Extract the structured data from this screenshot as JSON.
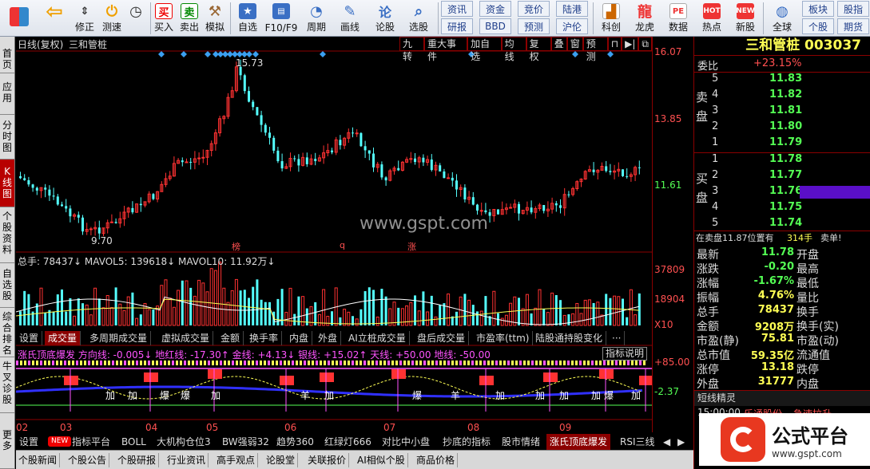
{
  "toolbar": {
    "items": [
      {
        "label": "",
        "icon": "grid-icon"
      },
      {
        "label": "",
        "icon": "back-arrow-icon"
      },
      {
        "label": "修正",
        "icon": "up-down-icon"
      },
      {
        "label": "测速",
        "icon": "power-icon"
      },
      {
        "label": "",
        "icon": "clock-icon"
      },
      {
        "label": "买入",
        "icon": "buy-icon"
      },
      {
        "label": "卖出",
        "icon": "sell-icon"
      },
      {
        "label": "模拟",
        "icon": "hammer-icon"
      },
      {
        "label": "自选",
        "icon": "star-icon"
      },
      {
        "label": "F10/F9",
        "icon": "f10-icon"
      },
      {
        "label": "周期",
        "icon": "period-icon"
      },
      {
        "label": "画线",
        "icon": "pencil-icon"
      },
      {
        "label": "论股",
        "icon": "chat-icon"
      },
      {
        "label": "选股",
        "icon": "magnifier-icon"
      },
      {
        "label": "资讯",
        "icon": ""
      },
      {
        "label": "研报",
        "icon": ""
      },
      {
        "label": "资金",
        "icon": ""
      },
      {
        "label": "BBD",
        "icon": ""
      },
      {
        "label": "竞价",
        "icon": ""
      },
      {
        "label": "预测",
        "icon": ""
      },
      {
        "label": "陆港",
        "icon": ""
      },
      {
        "label": "沪伦",
        "icon": ""
      },
      {
        "label": "科创",
        "icon": "chart-icon"
      },
      {
        "label": "龙虎",
        "icon": "dragon-icon"
      },
      {
        "label": "数据",
        "icon": "pe-icon"
      },
      {
        "label": "热点",
        "icon": "hot-icon"
      },
      {
        "label": "新股",
        "icon": "new-icon"
      },
      {
        "label": "全球",
        "icon": "globe-icon"
      },
      {
        "label": "板块",
        "icon": ""
      },
      {
        "label": "个股",
        "icon": ""
      },
      {
        "label": "股指",
        "icon": ""
      },
      {
        "label": "期货",
        "icon": ""
      }
    ]
  },
  "leftnav": [
    "首页",
    "应用",
    "分时图",
    "K线图",
    "个股资料",
    "自选股",
    "综合排名",
    "牛叉诊股",
    "更多"
  ],
  "chart_header": {
    "title": "日线(复权)",
    "stock": "三和管桩",
    "buttons": [
      "九转",
      "重大事件",
      "加自选",
      "均线",
      "复权",
      "叠",
      "窗",
      "预测"
    ]
  },
  "price_axis": [
    "16.07",
    "13.85",
    "11.61"
  ],
  "price_annotations": {
    "high": "15.73",
    "low": "9.70",
    "markers": [
      "榜",
      "q",
      "涨"
    ]
  },
  "volume": {
    "legend": "总手: 78437↓ MAVOL5: 139618↓ MAVOL10: 11.92万↓",
    "axis": [
      "37809",
      "18904",
      "X10"
    ]
  },
  "vol_tabs": [
    "设置",
    "成交量",
    "多周期成交量",
    "虚拟成交量",
    "金额",
    "换手率",
    "内盘",
    "外盘",
    "AI立桩成交量",
    "盘后成交量",
    "市盈率(ttm)",
    "陆股通持股变化",
    "···"
  ],
  "indicator": {
    "legend": "涨氏顶底爆发 方向线: -0.005↓ 地红线: -17.30↑ 金线: +4.13↓ 银线: +15.02↑ 天线: +50.00 地线: -50.00",
    "button": "指标说明",
    "axis": [
      "+85.00",
      "-2.37"
    ],
    "labels": [
      "加",
      "加",
      "爆",
      "爆",
      "加",
      "羊",
      "加",
      "爆",
      "羊",
      "加",
      "加",
      "加",
      "加",
      "爆",
      "加"
    ]
  },
  "months": [
    "02",
    "03",
    "04",
    "05",
    "06",
    "07",
    "08",
    "09"
  ],
  "bottom_tabs": [
    "设置",
    "NEW",
    "指标平台",
    "BOLL",
    "大机构仓位3",
    "BW强弱32",
    "趋势360",
    "红绿灯666",
    "对比中小盘",
    "抄底的指标",
    "股市情绪",
    "涨氏顶底爆发",
    "RSI三线"
  ],
  "bottom_tabs2": [
    "个股新闻",
    "个股公告",
    "个股研报",
    "行业资讯",
    "高手观点",
    "论股堂",
    "关联报价",
    "AI相似个股",
    "商品价格"
  ],
  "right": {
    "name": "三和管桩",
    "code": "003037",
    "weibi": {
      "label": "委比",
      "value": "+23.15%"
    },
    "sell_label": "卖盘",
    "buy_label": "买盘",
    "sells": [
      {
        "lv": "5",
        "price": "11.83"
      },
      {
        "lv": "4",
        "price": "11.82"
      },
      {
        "lv": "3",
        "price": "11.81"
      },
      {
        "lv": "2",
        "price": "11.80"
      },
      {
        "lv": "1",
        "price": "11.79"
      }
    ],
    "buys": [
      {
        "lv": "1",
        "price": "11.78"
      },
      {
        "lv": "2",
        "price": "11.77"
      },
      {
        "lv": "3",
        "price": "11.76"
      },
      {
        "lv": "4",
        "price": "11.75"
      },
      {
        "lv": "5",
        "price": "11.74"
      }
    ],
    "notice": "在卖盘11.87位置有",
    "notice_val": "314手",
    "notice_end": "卖单!",
    "stats": [
      [
        "最新",
        "11.78",
        "开盘",
        ""
      ],
      [
        "涨跌",
        "-0.20",
        "最高",
        ""
      ],
      [
        "涨幅",
        "-1.67%",
        "最低",
        ""
      ],
      [
        "振幅",
        "4.76%",
        "量比",
        ""
      ],
      [
        "总手",
        "78437",
        "换手",
        ""
      ],
      [
        "金额",
        "9208万",
        "换手(实)",
        ""
      ],
      [
        "市盈(静)",
        "75.81",
        "市盈(动)",
        ""
      ],
      [
        "总市值",
        "59.35亿",
        "流通值",
        ""
      ],
      [
        "涨停",
        "13.18",
        "跌停",
        ""
      ],
      [
        "外盘",
        "31777",
        "内盘",
        ""
      ]
    ],
    "section": "短线精灵",
    "feed": [
      {
        "time": "15:00:00",
        "name": "乐通股份",
        "event": "急速拉升"
      }
    ]
  },
  "watermark": "www.gspt.com",
  "logo": {
    "text": "公式平台",
    "url": "www.gspt.com"
  },
  "colors": {
    "up": "#ff3232",
    "down": "#54ffff",
    "yellow": "#ffff54",
    "magenta": "#ff54ff",
    "accent": "#8b0000"
  }
}
